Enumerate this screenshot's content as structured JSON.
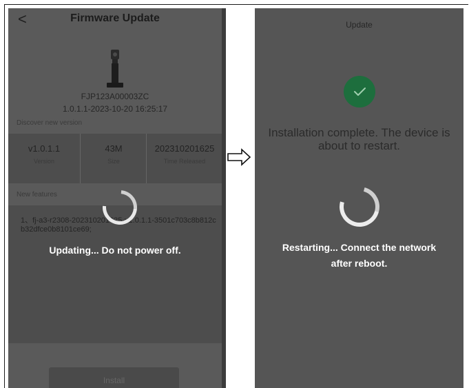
{
  "left_screen": {
    "header": {
      "back_glyph": "<",
      "title": "Firmware Update"
    },
    "device": {
      "serial": "FJP123A00003ZC",
      "version_date": "1.0.1.1-2023-10-20 16:25:17"
    },
    "discover_label": "Discover new version",
    "info": [
      {
        "value": "v1.0.1.1",
        "label": "Version"
      },
      {
        "value": "43M",
        "label": "Size"
      },
      {
        "value": "202310201625",
        "label": "Time Released"
      }
    ],
    "new_features_label": "New features",
    "new_features_text": "1、fj-a3-r2308-202310201625-v1.0.1.1-3501c703c8b812cb32dfce0b8101ce69;",
    "overlay_message": "Updating... Do not power off.",
    "install_button": "Install"
  },
  "arrow_icon": "right-arrow-icon",
  "right_screen": {
    "title": "Update",
    "install_complete": "Installation complete. The device is about to restart.",
    "restart_line1": "Restarting... Connect the network",
    "restart_line2": "after reboot."
  },
  "colors": {
    "success_green": "#1d6e3d",
    "overlay_gray": "#5a5a5a"
  }
}
